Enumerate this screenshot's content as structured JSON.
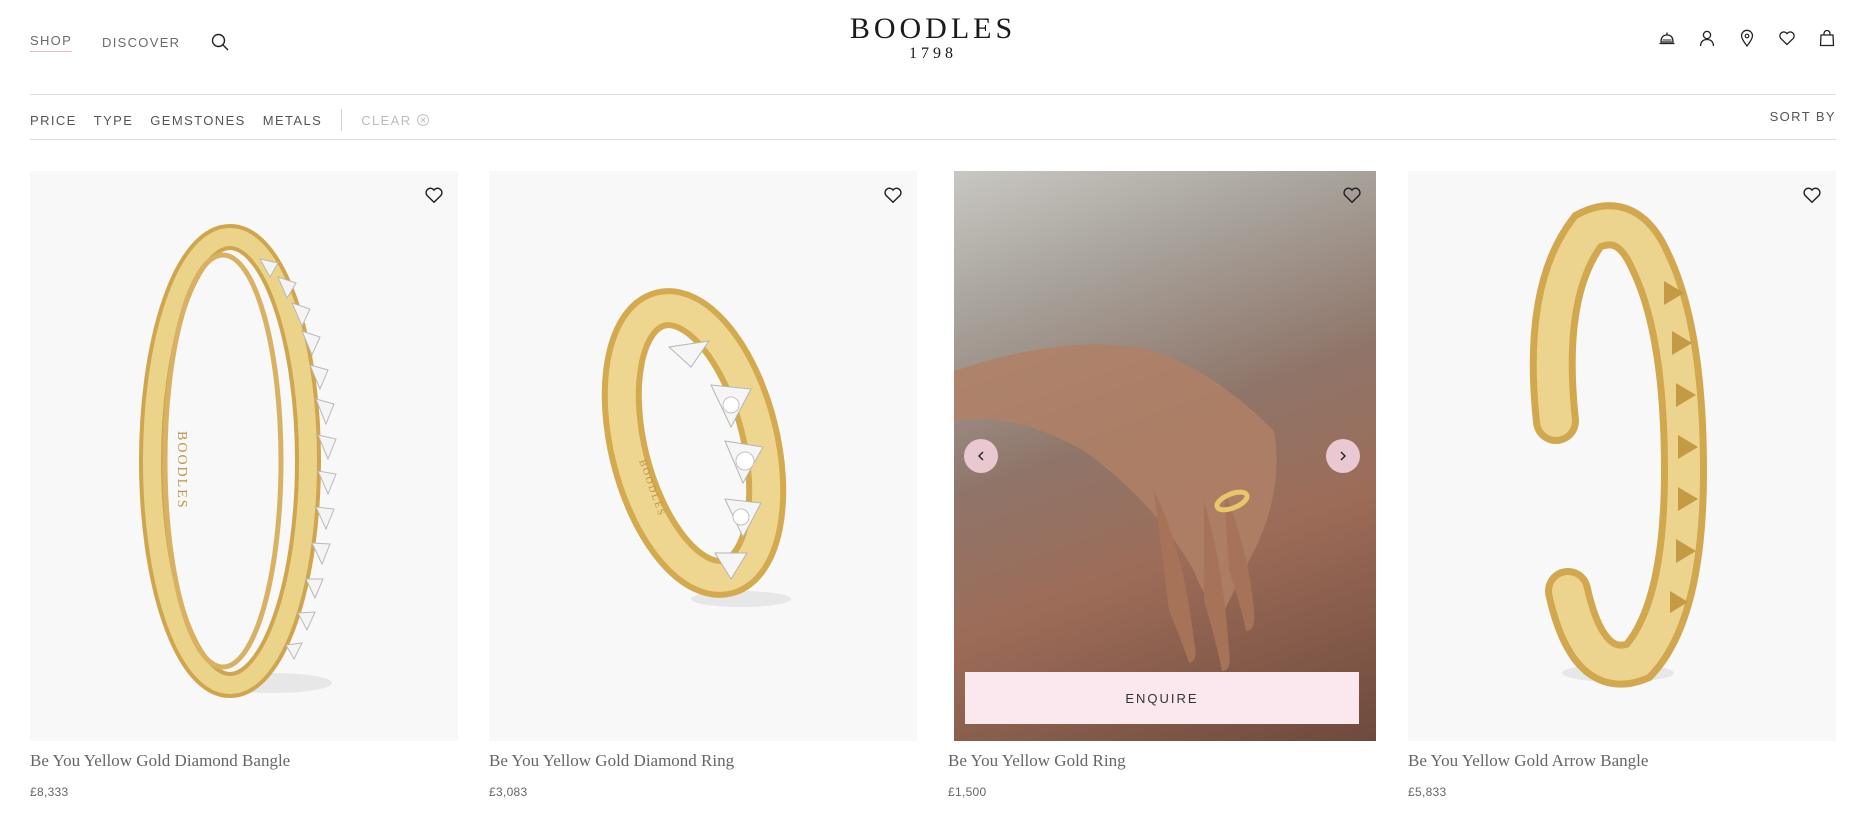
{
  "header": {
    "nav": {
      "shop": "SHOP",
      "discover": "DISCOVER"
    },
    "logo": {
      "name": "BOODLES",
      "year": "1798"
    },
    "icons": [
      "concierge-bell-icon",
      "account-icon",
      "location-pin-icon",
      "wishlist-heart-icon",
      "shopping-bag-icon"
    ]
  },
  "filters": {
    "items": [
      "PRICE",
      "TYPE",
      "GEMSTONES",
      "METALS"
    ],
    "clear": "CLEAR",
    "sort": "SORT BY"
  },
  "colors": {
    "accent_pink": "#fae8ee",
    "arrow_pink": "#eac8d1",
    "gold": "#e6c56f"
  },
  "products": [
    {
      "title": "Be You Yellow Gold Diamond Bangle",
      "price": "£8,333"
    },
    {
      "title": "Be You Yellow Gold Diamond Ring",
      "price": "£3,083"
    },
    {
      "title": "Be You Yellow Gold Ring",
      "price": "£1,500",
      "cta": "ENQUIRE"
    },
    {
      "title": "Be You Yellow Gold Arrow Bangle",
      "price": "£5,833"
    }
  ]
}
